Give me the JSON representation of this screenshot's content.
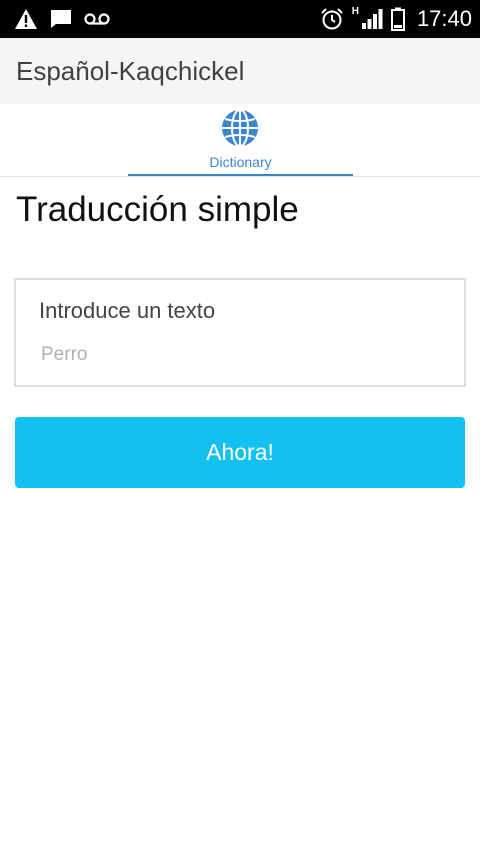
{
  "status_bar": {
    "time": "17:40",
    "network_type": "H",
    "icons": [
      "warning-icon",
      "message-icon",
      "voicemail-icon",
      "alarm-icon",
      "signal-icon",
      "battery-icon"
    ]
  },
  "app_bar": {
    "title": "Español-Kaqchickel"
  },
  "tabs": [
    {
      "label": "Dictionary",
      "icon": "globe-icon",
      "selected": true
    }
  ],
  "main": {
    "title": "Traducción simple",
    "input": {
      "label": "Introduce un texto",
      "placeholder": "Perro",
      "value": ""
    },
    "button_label": "Ahora!"
  },
  "colors": {
    "accent": "#3a86d0",
    "button": "#12c1ef",
    "status_bar": "#000000",
    "app_bar": "#f5f5f5"
  }
}
